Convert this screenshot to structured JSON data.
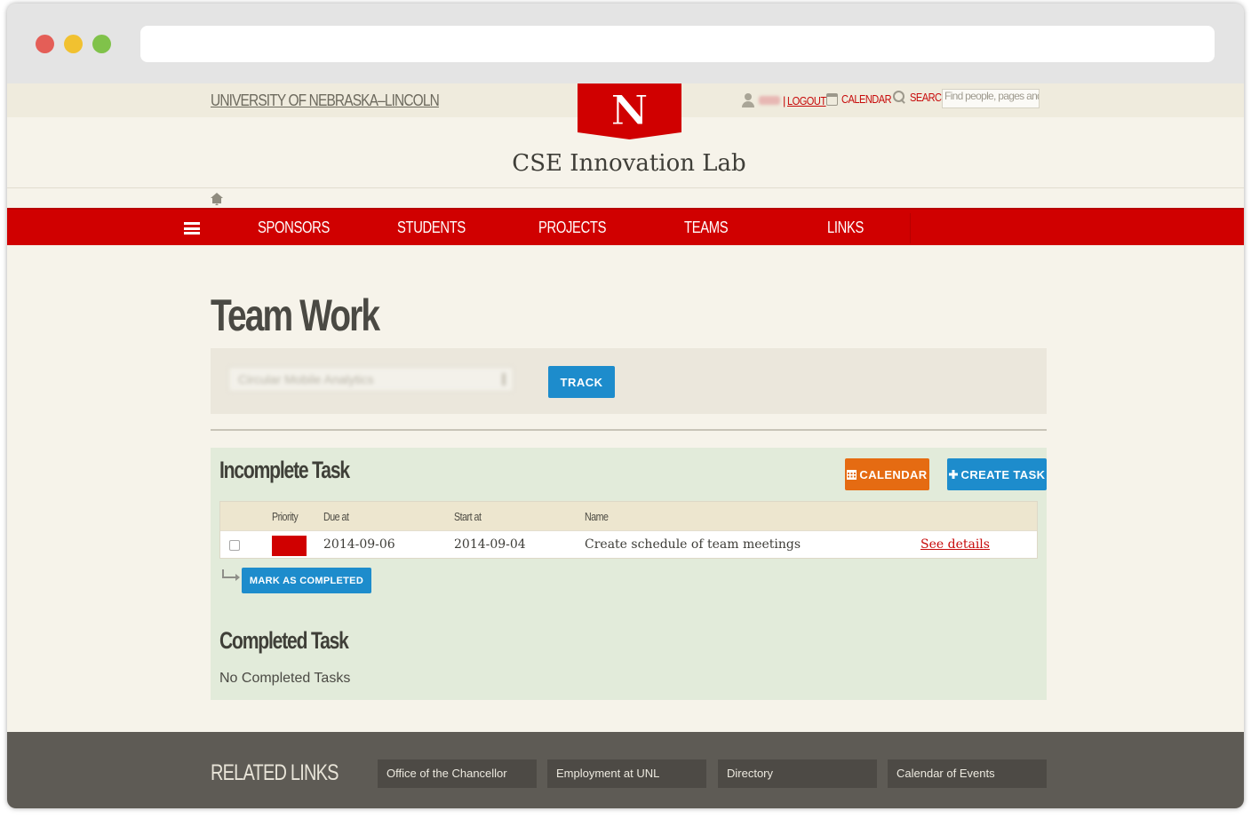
{
  "header": {
    "university_link": "UNIVERSITY OF NEBRASKA–LINCOLN",
    "logo_letter": "N",
    "logout": "LOGOUT",
    "separator": "|",
    "calendar": "CALENDAR",
    "search_label": "SEARCH",
    "search_placeholder": "Find people, pages and things"
  },
  "site_title": "CSE Innovation Lab",
  "nav": {
    "items": [
      "SPONSORS",
      "STUDENTS",
      "PROJECTS",
      "TEAMS",
      "LINKS"
    ]
  },
  "main": {
    "heading": "Team Work",
    "project_select_value": "Circular Mobile Analytics",
    "track_button": "TRACK",
    "incomplete": {
      "title": "Incomplete Task",
      "calendar_button": "CALENDAR",
      "create_button": "CREATE TASK",
      "columns": [
        "Priority",
        "Due at",
        "Start at",
        "Name"
      ],
      "rows": [
        {
          "priority_color": "#d00000",
          "due_at": "2014-09-06",
          "start_at": "2014-09-04",
          "name": "Create schedule of team meetings",
          "details_link": "See details"
        }
      ],
      "mark_button": "MARK AS COMPLETED"
    },
    "completed": {
      "title": "Completed Task",
      "empty_message": "No Completed Tasks"
    }
  },
  "footer": {
    "title": "RELATED LINKS",
    "links": [
      "Office of the Chancellor",
      "Employment at UNL",
      "Directory",
      "Calendar of Events"
    ]
  },
  "colors": {
    "brand_red": "#d00000",
    "primary_blue": "#1d8ccc",
    "calendar_orange": "#e56b12"
  }
}
